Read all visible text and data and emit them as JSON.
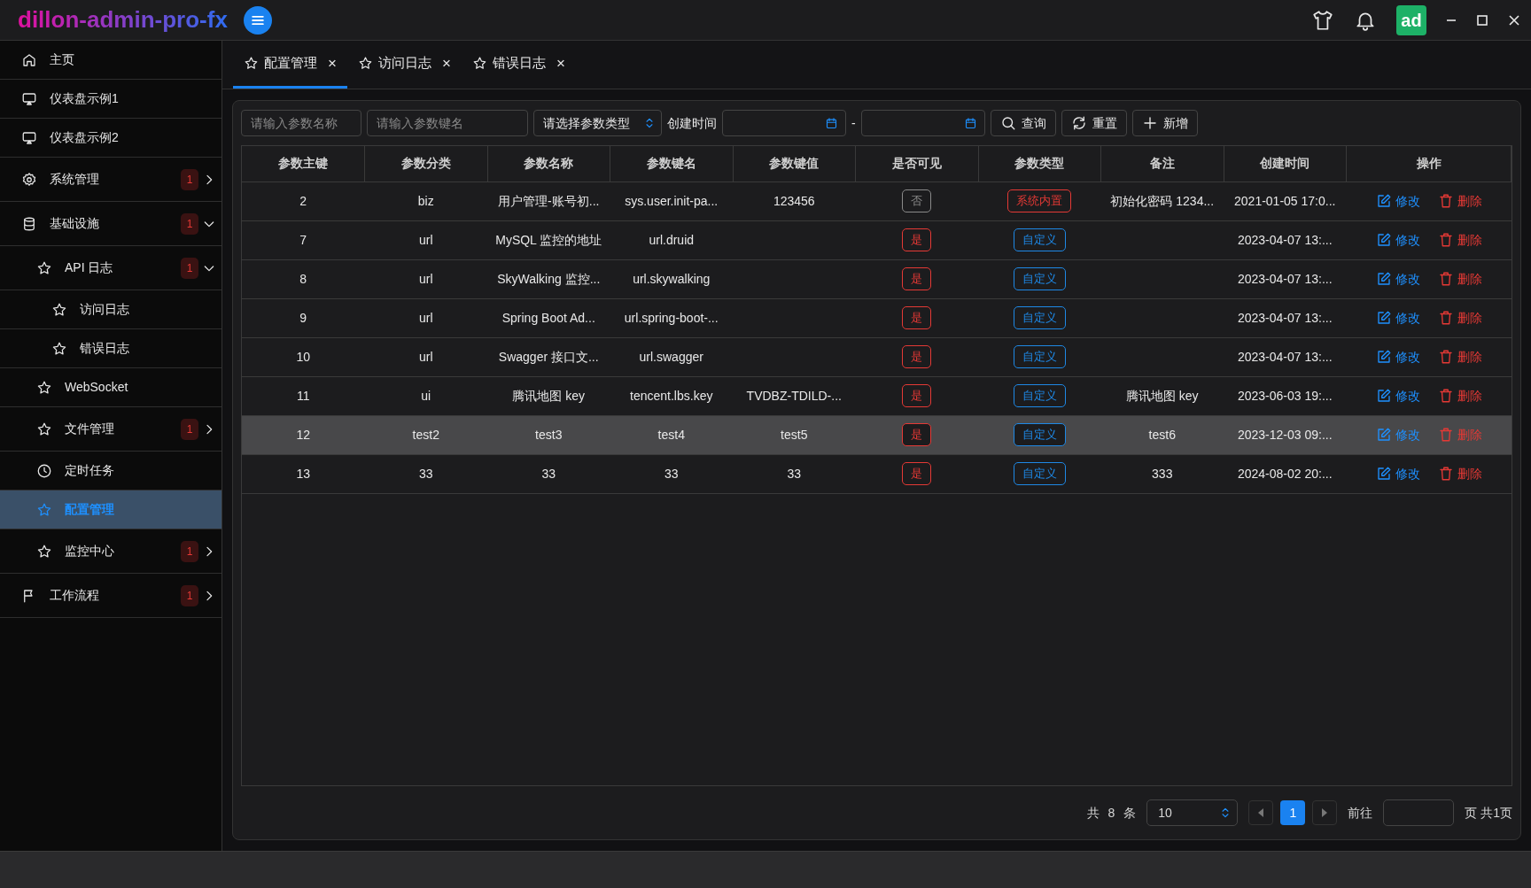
{
  "app": {
    "title": "dillon-admin-pro-fx",
    "avatar": "ad"
  },
  "sidebar": {
    "items": [
      {
        "label": "主页",
        "kind": "home",
        "selected": false
      },
      {
        "label": "仪表盘示例1",
        "kind": "monitor",
        "selected": false
      },
      {
        "label": "仪表盘示例2",
        "kind": "monitor",
        "selected": false
      },
      {
        "label": "系统管理",
        "kind": "gear",
        "selected": false,
        "badge": "1",
        "expanded": false
      },
      {
        "label": "基础设施",
        "kind": "database",
        "selected": false,
        "badge": "1",
        "expanded": true,
        "children": [
          {
            "label": "API 日志",
            "kind": "star",
            "selected": false,
            "badge": "1",
            "expanded": true,
            "children": [
              {
                "label": "访问日志",
                "kind": "star",
                "selected": false
              },
              {
                "label": "错误日志",
                "kind": "star",
                "selected": false
              }
            ]
          },
          {
            "label": "WebSocket",
            "kind": "star",
            "selected": false
          },
          {
            "label": "文件管理",
            "kind": "star",
            "selected": false,
            "badge": "1",
            "expanded": false
          },
          {
            "label": "定时任务",
            "kind": "clock",
            "selected": false
          },
          {
            "label": "配置管理",
            "kind": "star",
            "selected": true
          },
          {
            "label": "监控中心",
            "kind": "star",
            "selected": false,
            "badge": "1",
            "expanded": false
          }
        ]
      },
      {
        "label": "工作流程",
        "kind": "flag",
        "selected": false,
        "badge": "1",
        "expanded": false
      }
    ]
  },
  "tabs": [
    {
      "label": "配置管理",
      "selected": true,
      "close": "×"
    },
    {
      "label": "访问日志",
      "selected": false,
      "close": "×"
    },
    {
      "label": "错误日志",
      "selected": false,
      "close": "×"
    }
  ],
  "filters": {
    "name": {
      "placeholder": "请输入参数名称"
    },
    "key": {
      "placeholder": "请输入参数键名"
    },
    "type": {
      "placeholder": "请选择参数类型"
    },
    "date_label": "创建时间",
    "date_separator": "-",
    "buttons": [
      {
        "kind": "search",
        "label": "查询"
      },
      {
        "kind": "reset",
        "label": "重置"
      },
      {
        "kind": "add",
        "label": "新增"
      }
    ]
  },
  "table": {
    "columns": [
      "参数主键",
      "参数分类",
      "参数名称",
      "参数键名",
      "参数键值",
      "是否可见",
      "参数类型",
      "备注",
      "创建时间",
      "操作"
    ],
    "rows": [
      {
        "id": "2",
        "category": "biz",
        "name": "用户管理-账号初...",
        "key": "sys.user.init-pa...",
        "value": "123456",
        "visible": {
          "label": "否",
          "color": "#8a8a8a"
        },
        "type": {
          "label": "系统内置",
          "color": "#e53935"
        },
        "remark": "初始化密码 1234...",
        "created": "2021-01-05 17:0...",
        "selected": false,
        "actions": [
          {
            "kind": "edit",
            "label": "修改"
          },
          {
            "kind": "delete",
            "label": "删除"
          }
        ]
      },
      {
        "id": "7",
        "category": "url",
        "name": "MySQL 监控的地址",
        "key": "url.druid",
        "value": "",
        "visible": {
          "label": "是",
          "color": "#e53935"
        },
        "type": {
          "label": "自定义",
          "color": "#1e88e5"
        },
        "remark": "",
        "created": "2023-04-07 13:...",
        "selected": false,
        "actions": [
          {
            "kind": "edit",
            "label": "修改"
          },
          {
            "kind": "delete",
            "label": "删除"
          }
        ]
      },
      {
        "id": "8",
        "category": "url",
        "name": "SkyWalking 监控...",
        "key": "url.skywalking",
        "value": "",
        "visible": {
          "label": "是",
          "color": "#e53935"
        },
        "type": {
          "label": "自定义",
          "color": "#1e88e5"
        },
        "remark": "",
        "created": "2023-04-07 13:...",
        "selected": false,
        "actions": [
          {
            "kind": "edit",
            "label": "修改"
          },
          {
            "kind": "delete",
            "label": "删除"
          }
        ]
      },
      {
        "id": "9",
        "category": "url",
        "name": "Spring Boot Ad...",
        "key": "url.spring-boot-...",
        "value": "",
        "visible": {
          "label": "是",
          "color": "#e53935"
        },
        "type": {
          "label": "自定义",
          "color": "#1e88e5"
        },
        "remark": "",
        "created": "2023-04-07 13:...",
        "selected": false,
        "actions": [
          {
            "kind": "edit",
            "label": "修改"
          },
          {
            "kind": "delete",
            "label": "删除"
          }
        ]
      },
      {
        "id": "10",
        "category": "url",
        "name": "Swagger 接口文...",
        "key": "url.swagger",
        "value": "",
        "visible": {
          "label": "是",
          "color": "#e53935"
        },
        "type": {
          "label": "自定义",
          "color": "#1e88e5"
        },
        "remark": "",
        "created": "2023-04-07 13:...",
        "selected": false,
        "actions": [
          {
            "kind": "edit",
            "label": "修改"
          },
          {
            "kind": "delete",
            "label": "删除"
          }
        ]
      },
      {
        "id": "11",
        "category": "ui",
        "name": "腾讯地图 key",
        "key": "tencent.lbs.key",
        "value": "TVDBZ-TDILD-...",
        "visible": {
          "label": "是",
          "color": "#e53935"
        },
        "type": {
          "label": "自定义",
          "color": "#1e88e5"
        },
        "remark": "腾讯地图 key",
        "created": "2023-06-03 19:...",
        "selected": false,
        "actions": [
          {
            "kind": "edit",
            "label": "修改"
          },
          {
            "kind": "delete",
            "label": "删除"
          }
        ]
      },
      {
        "id": "12",
        "category": "test2",
        "name": "test3",
        "key": "test4",
        "value": "test5",
        "visible": {
          "label": "是",
          "color": "#e53935"
        },
        "type": {
          "label": "自定义",
          "color": "#1e88e5"
        },
        "remark": "test6",
        "created": "2023-12-03 09:...",
        "selected": true,
        "actions": [
          {
            "kind": "edit",
            "label": "修改"
          },
          {
            "kind": "delete",
            "label": "删除"
          }
        ]
      },
      {
        "id": "13",
        "category": "33",
        "name": "33",
        "key": "33",
        "value": "33",
        "visible": {
          "label": "是",
          "color": "#e53935"
        },
        "type": {
          "label": "自定义",
          "color": "#1e88e5"
        },
        "remark": "333",
        "created": "2024-08-02 20:...",
        "selected": false,
        "actions": [
          {
            "kind": "edit",
            "label": "修改"
          },
          {
            "kind": "delete",
            "label": "删除"
          }
        ]
      }
    ]
  },
  "pagination": {
    "total": "共 8 条",
    "page_size": "10",
    "pages": [
      {
        "label": "1",
        "selected": true
      }
    ],
    "goto_label": "前往",
    "page_count": "页 共1页"
  }
}
